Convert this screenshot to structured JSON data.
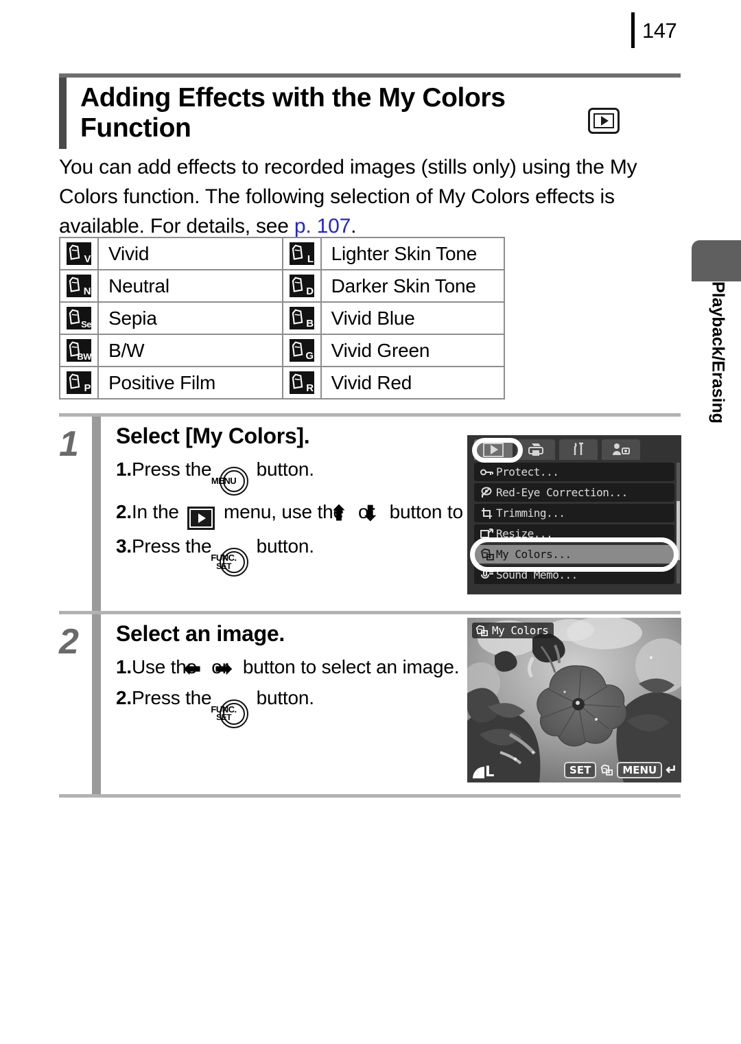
{
  "page": {
    "number": "147",
    "side_tab_label": "Playback/Erasing"
  },
  "header": {
    "title": "Adding Effects with the My Colors Function",
    "badge_icon": "playback-icon"
  },
  "intro": {
    "line1": "You can add effects to recorded images (stills only) using the My",
    "line2": "Colors function. The following selection of My Colors effects is",
    "line3_before": "available. For details, see ",
    "link": "p. 107",
    "line3_after": "."
  },
  "effects_table": {
    "rows": [
      {
        "left_icon": "my-colors-vivid-icon",
        "left_sub": "V",
        "left_label": "Vivid",
        "right_icon": "my-colors-lighter-skin-icon",
        "right_sub": "L",
        "right_label": "Lighter Skin Tone"
      },
      {
        "left_icon": "my-colors-neutral-icon",
        "left_sub": "N",
        "left_label": "Neutral",
        "right_icon": "my-colors-darker-skin-icon",
        "right_sub": "D",
        "right_label": "Darker Skin Tone"
      },
      {
        "left_icon": "my-colors-sepia-icon",
        "left_sub": "Se",
        "left_label": "Sepia",
        "right_icon": "my-colors-vivid-blue-icon",
        "right_sub": "B",
        "right_label": "Vivid Blue"
      },
      {
        "left_icon": "my-colors-bw-icon",
        "left_sub": "BW",
        "left_label": "B/W",
        "right_icon": "my-colors-vivid-green-icon",
        "right_sub": "G",
        "right_label": "Vivid Green"
      },
      {
        "left_icon": "my-colors-positive-film-icon",
        "left_sub": "P",
        "left_label": "Positive Film",
        "right_icon": "my-colors-vivid-red-icon",
        "right_sub": "R",
        "right_label": "Vivid Red"
      }
    ]
  },
  "step1": {
    "number": "1",
    "heading": "Select [My Colors].",
    "item1_num": "1.",
    "item1_a": "Press the ",
    "item1_btn": "MENU",
    "item1_b": " button.",
    "item2_num": "2.",
    "item2_a": "In the ",
    "item2_b": " menu, use the ",
    "item2_or": " or ",
    "item2_c": " button to select ",
    "item2_d": ".",
    "item3_num": "3.",
    "item3_a": "Press the ",
    "item3_btn_top": "FUNC.",
    "item3_btn_bottom": "SET",
    "item3_b": " button.",
    "arrow_up": "⬆",
    "arrow_down": "⬇"
  },
  "step2": {
    "number": "2",
    "heading": "Select an image.",
    "item1_num": "1.",
    "item1_a": "Use the ",
    "item1_or": " or ",
    "item1_b": " button to select an image.",
    "item2_num": "2.",
    "item2_a": "Press the ",
    "item2_btn_top": "FUNC.",
    "item2_btn_bottom": "SET",
    "item2_b": " button.",
    "arrow_left": "⬅",
    "arrow_right": "➡"
  },
  "lcd_menu": {
    "tabs": [
      {
        "name": "playback-tab",
        "selected": true
      },
      {
        "name": "print-tab",
        "selected": false
      },
      {
        "name": "settings-tab",
        "selected": false
      },
      {
        "name": "my-camera-tab",
        "selected": false
      }
    ],
    "items": [
      {
        "label": "Protect...",
        "icon": "key-icon",
        "highlighted": false
      },
      {
        "label": "Red-Eye Correction...",
        "icon": "red-eye-icon",
        "highlighted": false
      },
      {
        "label": "Trimming...",
        "icon": "crop-icon",
        "highlighted": false
      },
      {
        "label": "Resize...",
        "icon": "resize-icon",
        "highlighted": false
      },
      {
        "label": "My Colors...",
        "icon": "my-colors-icon",
        "highlighted": true
      },
      {
        "label": "Sound Memo...",
        "icon": "sound-memo-icon",
        "highlighted": false
      }
    ]
  },
  "lcd_photo": {
    "title": "My Colors",
    "title_icon": "my-colors-icon",
    "set_label": "SET",
    "menu_label": "MENU",
    "back_icon": "back-arrow-icon",
    "resolution": "L",
    "compression_icon": "fine-compression-icon"
  },
  "colors": {
    "link": "#2222dd",
    "rule_gray": "#b2b2b2",
    "bar_gray": "#9a9a9a",
    "title_bar": "#4a4a4a",
    "side_tab": "#5f5f5f",
    "lcd_bg": "#333333",
    "lcd_item": "#1c1c1c",
    "lcd_highlight": "#8a8a8a"
  }
}
